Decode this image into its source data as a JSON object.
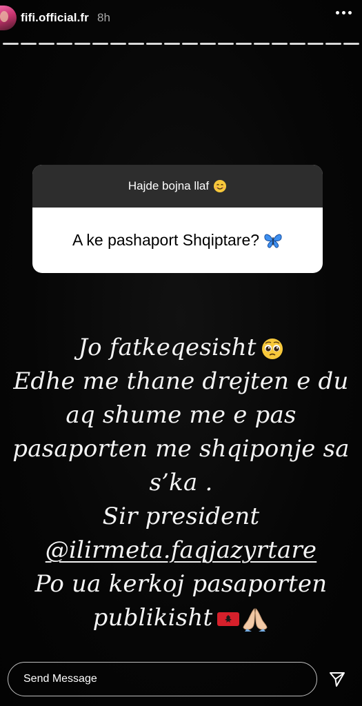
{
  "header": {
    "username": "fifi.official.fr",
    "time": "8h"
  },
  "progress": {
    "segments": 20,
    "current": 20
  },
  "sticker": {
    "prompt": "Hajde bojna llaf",
    "prompt_emoji": "smiling-face-icon",
    "question": "A ke pashaport Shqiptare?",
    "question_emoji": "butterfly-icon"
  },
  "answer": {
    "lines": [
      "Jo fatkeqesisht",
      "Edhe me thane drejten e du",
      "aq shume me e pas",
      "pasaporten me shqiponje sa",
      "s’ka .",
      "Sir president",
      "@ilirmeta.faqjazyrtare",
      "Po ua kerkoj pasaporten",
      "publikisht"
    ],
    "emojis": {
      "line_0": "pleading-face-icon",
      "line_8": [
        "albania-flag-icon",
        "folded-hands-icon"
      ]
    }
  },
  "footer": {
    "placeholder": "Send Message"
  },
  "colors": {
    "background": "#050505",
    "sticker_header": "#2d2d2d",
    "sticker_body": "#ffffff",
    "text": "#f4f4f4"
  }
}
